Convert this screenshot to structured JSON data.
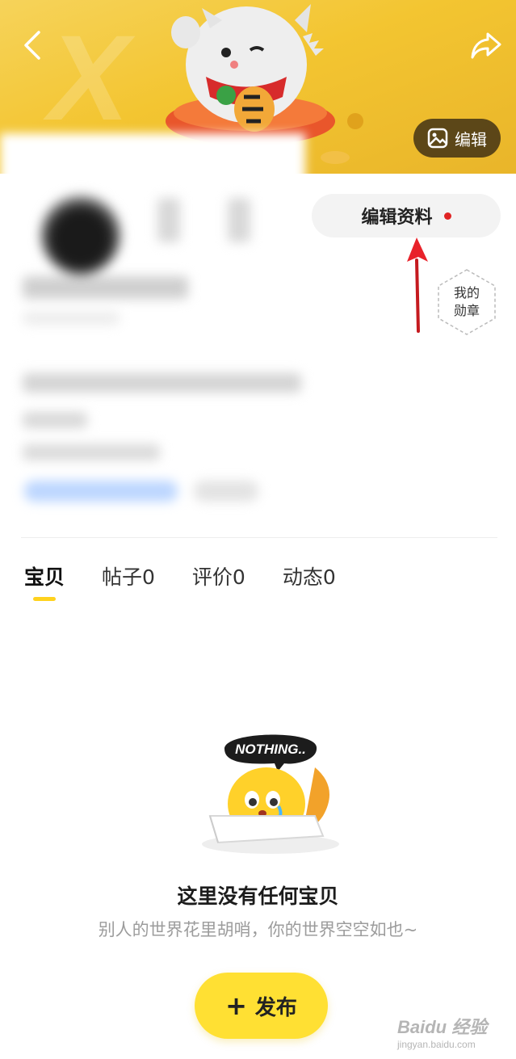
{
  "header": {
    "cover_edit_label": "编辑",
    "edit_profile_label": "编辑资料"
  },
  "badge": {
    "label": "我的勋章"
  },
  "tabs": [
    {
      "label": "宝贝",
      "active": true
    },
    {
      "label": "帖子0",
      "active": false
    },
    {
      "label": "评价0",
      "active": false
    },
    {
      "label": "动态0",
      "active": false
    }
  ],
  "empty_state": {
    "bubble_text": "NOTHING..",
    "title": "这里没有任何宝贝",
    "subtitle": "别人的世界花里胡哨，你的世界空空如也~"
  },
  "publish": {
    "label": "发布"
  },
  "watermark": {
    "main": "Baidu 经验",
    "sub": "jingyan.baidu.com"
  },
  "colors": {
    "cover": "#f3c531",
    "accent_yellow": "#ffe033",
    "notification_dot": "#e02424",
    "annotation_arrow": "#e8222a"
  },
  "icons": [
    "back-icon",
    "share-icon",
    "image-icon",
    "plus-icon",
    "hexagon-badge-icon"
  ]
}
